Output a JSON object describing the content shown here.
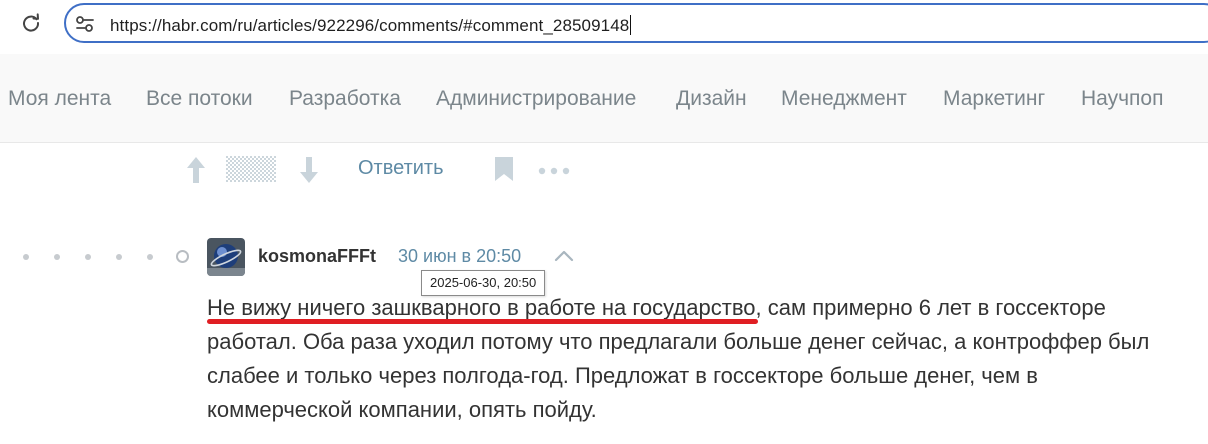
{
  "browser": {
    "url": "https://habr.com/ru/articles/922296/comments/#comment_28509148"
  },
  "nav": {
    "items": [
      "Моя лента",
      "Все потоки",
      "Разработка",
      "Администрирование",
      "Дизайн",
      "Менеджмент",
      "Маркетинг",
      "Научпоп"
    ]
  },
  "actions": {
    "reply_label": "Ответить"
  },
  "comment": {
    "author": "kosmonaFFFt",
    "time": "30 июн в 20:50",
    "tooltip": "2025-06-30, 20:50",
    "text_highlighted": "Не вижу ничего зашкварного в работе на государство",
    "text_rest": ", сам примерно 6 лет в госсекторе работал. Оба раза уходил потому что предлагали больше денег сейчас, а контроффер был слабее и только через полгода-год. Предложат в госсекторе больше денег, чем в коммерческой компании, опять пойду."
  },
  "colors": {
    "link": "#5e8aa5",
    "nav_text": "#7b858b",
    "omnibox_border": "#3f6fc6",
    "highlight_underline": "#e01e23"
  }
}
